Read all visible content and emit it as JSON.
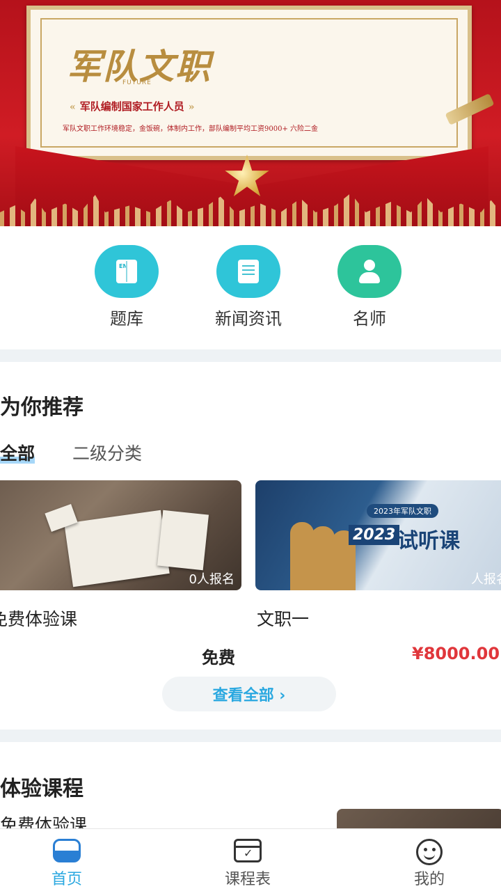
{
  "banner": {
    "title": "军队文职",
    "subtitle_en": "FUTURE",
    "subtitle": "军队编制国家工作人员",
    "description": "军队文职工作环境稳定，金饭碗，体制内工作，部队编制平均工资9000+ 六险二金"
  },
  "quick_links": [
    {
      "label": "题库",
      "icon": "book-icon",
      "color": "#2fc5d8"
    },
    {
      "label": "新闻资讯",
      "icon": "document-icon",
      "color": "#2fc5d8"
    },
    {
      "label": "名师",
      "icon": "teacher-icon",
      "color": "#2dc49b"
    }
  ],
  "recommend": {
    "title": "为你推荐",
    "tabs": [
      "全部",
      "二级分类"
    ],
    "cards": [
      {
        "name": "免费体验课",
        "enrolled": "0人报名",
        "price": "免费"
      },
      {
        "name": "文职一",
        "enrolled": "人报名",
        "price": "¥8000.00",
        "banner_top": "2023年军队文职",
        "banner_year": "2023",
        "banner_word": "试听课"
      }
    ],
    "view_all": "查看全部 ›"
  },
  "trial": {
    "title": "体验课程",
    "first_item": "免费体验课"
  },
  "nav": [
    {
      "label": "首页",
      "icon": "home-icon",
      "active": true
    },
    {
      "label": "课程表",
      "icon": "calendar-icon",
      "active": false
    },
    {
      "label": "我的",
      "icon": "smile-icon",
      "active": false
    }
  ],
  "colors": {
    "accent": "#2aa8e0",
    "price": "#e0363b",
    "banner": "#c8141d"
  }
}
